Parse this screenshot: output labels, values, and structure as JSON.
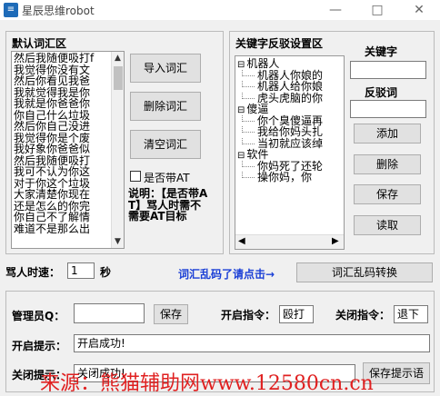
{
  "window": {
    "title": "星辰思维robot",
    "icon_glyph": "≡",
    "minimize": "—",
    "maximize": "□",
    "close": "✕"
  },
  "lexicon": {
    "title": "默认词汇区",
    "items": [
      "然后我随便吸打f",
      "我觉得你没有文",
      "然后你看见我爸",
      "我就觉得我是你",
      "我就是你爸爸你",
      "你自己什么垃圾",
      "然后你自己没进",
      "我觉得你是个废",
      "我好象你爸爸似",
      "然后我随便吸打",
      "我可不认为你这",
      "对于你这个垃圾",
      "大家清楚你现在",
      "还是怎么的你完",
      "你自己不了解情",
      "难道不是那么出"
    ],
    "import_button": "导入词汇",
    "delete_button": "删除词汇",
    "clear_button": "清空词汇",
    "at_checkbox_label": "是否带AT",
    "note": "说明：【是否带AT】骂人时需不需要AT目标"
  },
  "keywords": {
    "title": "关键字反驳设置区",
    "tree": [
      {
        "label": "机器人",
        "level": 0,
        "toggle": "⊟"
      },
      {
        "label": "机器人你娘的",
        "level": 1
      },
      {
        "label": "机器人给你娘",
        "level": 1
      },
      {
        "label": "虎头虎脑的你",
        "level": 1
      },
      {
        "label": "傻逼",
        "level": 0,
        "toggle": "⊟"
      },
      {
        "label": "你个臭傻逼再",
        "level": 1
      },
      {
        "label": "我给你妈头扎",
        "level": 1
      },
      {
        "label": "当初就应该绰",
        "level": 1
      },
      {
        "label": "软件",
        "level": 0,
        "toggle": "⊟"
      },
      {
        "label": "你妈死了还轮",
        "level": 1
      },
      {
        "label": "操你妈，你",
        "level": 1
      }
    ],
    "keyword_label": "关键字",
    "keyword_value": "",
    "rebuttal_label": "反驳词",
    "rebuttal_value": "",
    "add_button": "添加",
    "delete_button": "删除",
    "save_button": "保存",
    "load_button": "读取"
  },
  "speed": {
    "label": "骂人时速：",
    "value": "1",
    "unit": "秒",
    "hint": "词汇乱码了请点击→",
    "convert_button": "词汇乱码转换"
  },
  "settings": {
    "admin_label": "管理员Q：",
    "admin_value": "",
    "admin_save_button": "保存",
    "start_cmd_label": "开启指令：",
    "start_cmd_value": "殴打",
    "close_cmd_label": "关闭指令：",
    "close_cmd_value": "退下",
    "start_tip_label": "开启提示：",
    "start_tip_value": "开启成功!",
    "close_tip_label": "关闭提示：",
    "close_tip_value": "关闭成功!",
    "save_tip_button": "保存提示语"
  },
  "watermark": "来源：熊猫辅助网www.12580cn.cn",
  "colors": {
    "hint_blue": "#1a3fd6",
    "watermark_red": "#e02020"
  }
}
